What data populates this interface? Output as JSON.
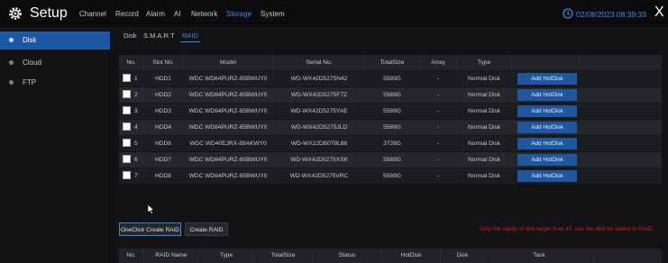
{
  "header": {
    "title": "Setup",
    "menu": [
      "Channel",
      "Record",
      "Alarm",
      "AI",
      "Network",
      "Storage",
      "System"
    ],
    "active_menu": "Storage",
    "datetime": "02/08/2023 08:39:33",
    "close": "X"
  },
  "sidebar": {
    "items": [
      {
        "label": "Disk",
        "active": true
      },
      {
        "label": "Cloud",
        "active": false
      },
      {
        "label": "FTP",
        "active": false
      }
    ]
  },
  "tabs": [
    "Disk",
    "S.M.A.R.T",
    "RAID"
  ],
  "active_tab": "RAID",
  "disk_table": {
    "columns": [
      "No.",
      "Slot No.",
      "Model",
      "Serial No.",
      "TotalSize",
      "Array",
      "Type"
    ],
    "rows": [
      {
        "no": "1",
        "slot": "HDD1",
        "model": "WDC WD64PURZ-85BWUY0",
        "serial": "WD-WX42D5275N42",
        "size": "5589G",
        "array": "-",
        "type": "Normal Disk",
        "action": "Add HotDisk"
      },
      {
        "no": "2",
        "slot": "HDD2",
        "model": "WDC WD64PURZ-85BWUY0",
        "serial": "WD-WX42D5275F7Z",
        "size": "5589G",
        "array": "-",
        "type": "Normal Disk",
        "action": "Add HotDisk"
      },
      {
        "no": "3",
        "slot": "HDD3",
        "model": "WDC WD64PURZ-85BWUY0",
        "serial": "WD-WX42D5275YAE",
        "size": "5589G",
        "array": "-",
        "type": "Normal Disk",
        "action": "Add HotDisk"
      },
      {
        "no": "4",
        "slot": "HDD4",
        "model": "WDC WD64PURZ-85BWUY0",
        "serial": "WD-WX42D5275JLD",
        "size": "5589G",
        "array": "-",
        "type": "Normal Disk",
        "action": "Add HotDisk"
      },
      {
        "no": "5",
        "slot": "HDD6",
        "model": "WDC WD40EJRX-89AKWY0",
        "serial": "WD-WX22DB078L86",
        "size": "3726G",
        "array": "-",
        "type": "Normal Disk",
        "action": "Add HotDisk"
      },
      {
        "no": "6",
        "slot": "HDD7",
        "model": "WDC WD64PURZ-85BWUY0",
        "serial": "WD-WX42D5275XSK",
        "size": "5589G",
        "array": "-",
        "type": "Normal Disk",
        "action": "Add HotDisk"
      },
      {
        "no": "7",
        "slot": "HDD8",
        "model": "WDC WD64PURZ-85BWUY0",
        "serial": "WD-WX42D5275VRC",
        "size": "5589G",
        "array": "-",
        "type": "Normal Disk",
        "action": "Add HotDisk"
      }
    ]
  },
  "actions": {
    "oneclick": "OneClick Create RAID",
    "create": "Create RAID"
  },
  "notice": "Only the capity of disk larger than 4T ,can the disk be added to RAID.",
  "raid_table": {
    "columns": [
      "No.",
      "RAID Name",
      "Type",
      "TotalSize",
      "Status",
      "HotDisk",
      "Disk",
      "Task"
    ]
  },
  "colors": {
    "accent": "#3a8ee8",
    "button": "#1f579e",
    "warning": "#d01e1e"
  }
}
